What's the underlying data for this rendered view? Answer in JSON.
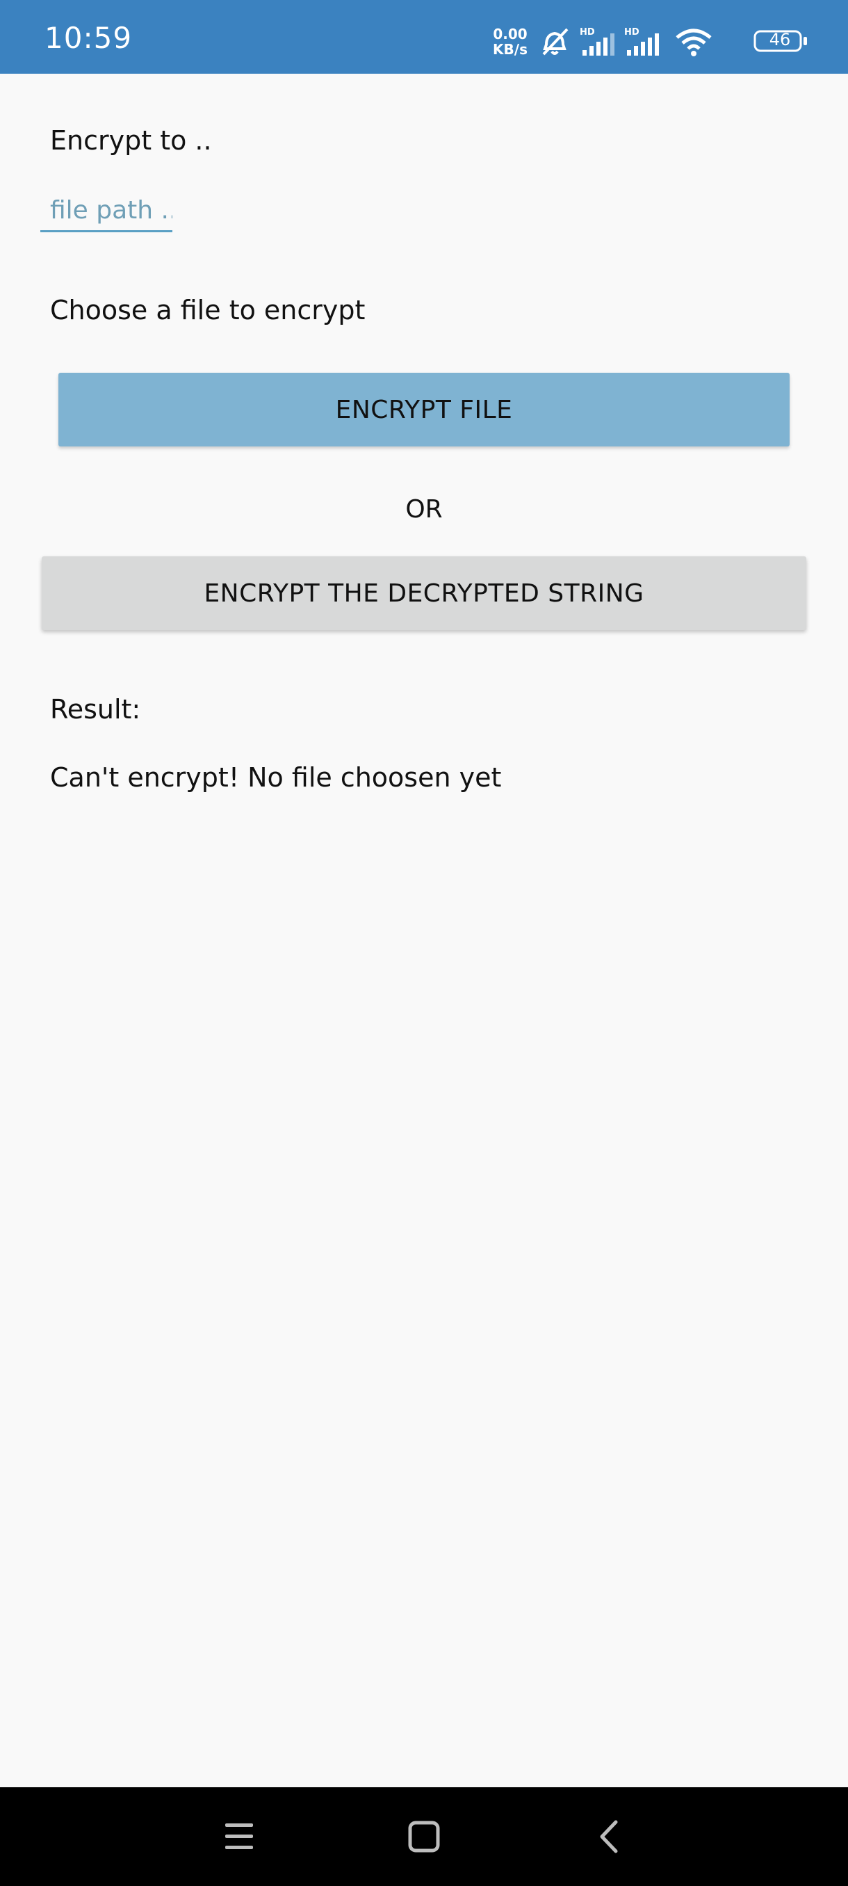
{
  "status_bar": {
    "time": "10:59",
    "net_speed_value": "0.00",
    "net_speed_unit": "KB/s",
    "signal_1_label": "HD",
    "signal_2_label": "HD",
    "battery_level": "46",
    "icons": [
      "mute-icon",
      "signal-icon",
      "signal-icon",
      "wifi-icon",
      "battery-icon"
    ]
  },
  "form": {
    "encrypt_to_label": "Encrypt to ..",
    "path_placeholder": "file path ..",
    "path_value": "",
    "choose_label": "Choose a file to encrypt",
    "encrypt_file_button": "ENCRYPT FILE",
    "or_label": "OR",
    "encrypt_string_button": "ENCRYPT THE DECRYPTED STRING",
    "result_label": "Result:",
    "result_text": "Can't encrypt! No file choosen yet"
  },
  "nav_bar": {
    "icons": [
      "menu-icon",
      "home-icon",
      "back-icon"
    ]
  },
  "colors": {
    "status_bar": "#3b82c0",
    "primary_button": "#7fb3d2",
    "secondary_button": "#d8d9d9",
    "background": "#f9f9f9"
  }
}
